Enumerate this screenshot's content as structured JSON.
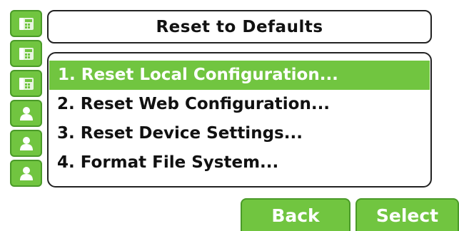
{
  "title": "Reset to Defaults",
  "line_keys": [
    {
      "icon": "desk-phone-icon"
    },
    {
      "icon": "desk-phone-icon"
    },
    {
      "icon": "desk-phone-icon"
    },
    {
      "icon": "contact-icon"
    },
    {
      "icon": "contact-icon"
    },
    {
      "icon": "contact-icon"
    }
  ],
  "menu": {
    "selected_index": 0,
    "items": [
      {
        "label": "1. Reset Local Configuration..."
      },
      {
        "label": "2. Reset Web Configuration..."
      },
      {
        "label": "3. Reset Device Settings..."
      },
      {
        "label": "4. Format File System..."
      }
    ]
  },
  "softkeys": {
    "back_label": "Back",
    "select_label": "Select"
  },
  "colors": {
    "accent": "#71c540",
    "accent_border": "#4a9a28",
    "text": "#111111"
  }
}
